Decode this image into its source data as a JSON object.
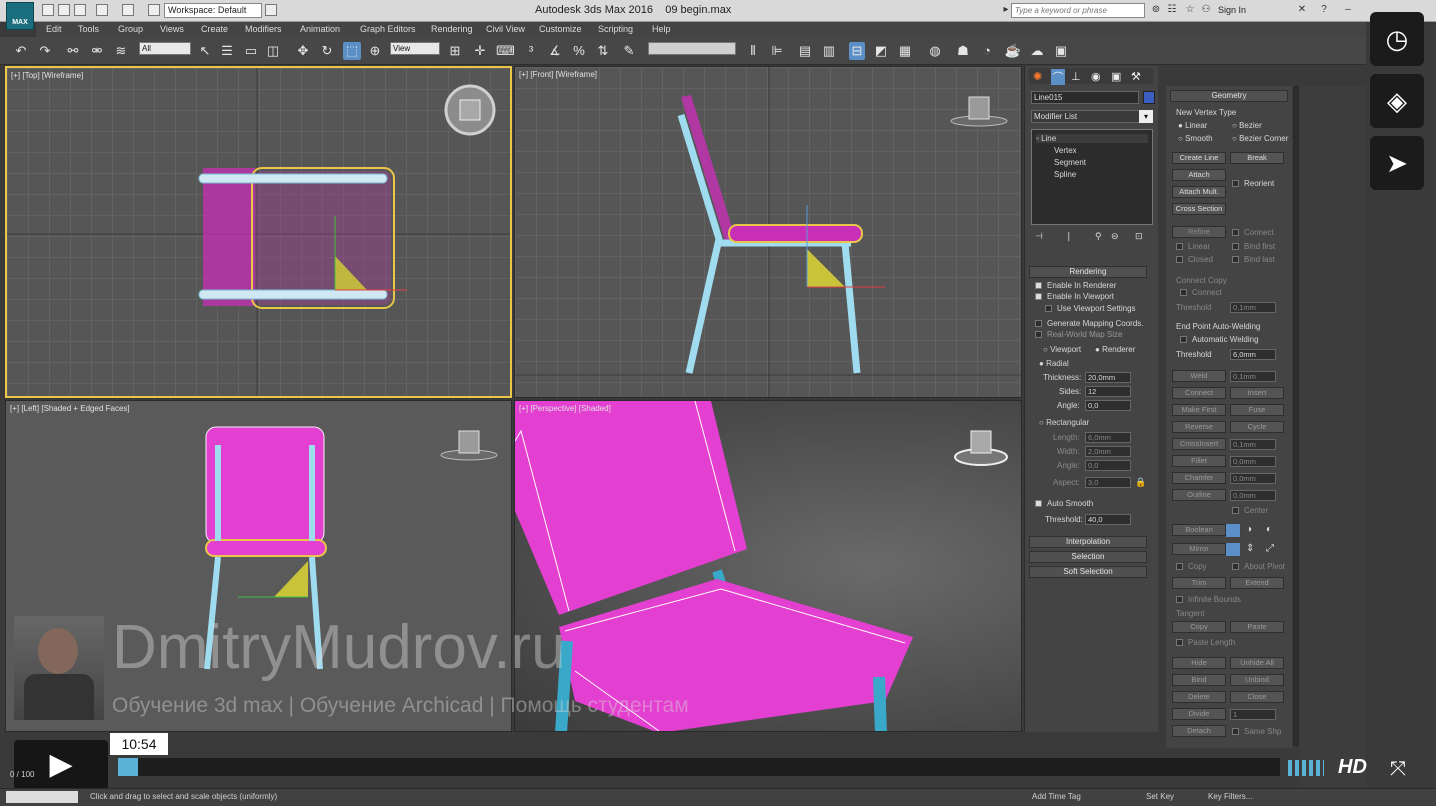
{
  "app": {
    "title": "Autodesk 3ds Max 2016",
    "file": "09 begin.max",
    "logo": "MAX",
    "workspace": "Workspace: Default",
    "search_placeholder": "Type a keyword or phrase",
    "signin": "Sign In"
  },
  "menu": [
    "Edit",
    "Tools",
    "Group",
    "Views",
    "Create",
    "Modifiers",
    "Animation",
    "Graph Editors",
    "Rendering",
    "Civil View",
    "Customize",
    "Scripting",
    "Help"
  ],
  "toolbar": {
    "selection_filter": "All",
    "ref_coord": "View"
  },
  "viewports": {
    "top": "[+] [Top] [Wireframe]",
    "front": "[+] [Front] [Wireframe]",
    "left": "[+] [Left] [Shaded + Edged Faces]",
    "perspective": "[+] [Perspective] [Shaded]"
  },
  "command_panel": {
    "object_name": "Line015",
    "modifier_list": "Modifier List",
    "stack": [
      "Line",
      "Vertex",
      "Segment",
      "Spline"
    ],
    "rendering": {
      "title": "Rendering",
      "enable_renderer": "Enable In Renderer",
      "enable_viewport": "Enable In Viewport",
      "use_viewport_settings": "Use Viewport Settings",
      "gen_mapping": "Generate Mapping Coords.",
      "real_world": "Real-World Map Size",
      "viewport_radio": "Viewport",
      "renderer_radio": "Renderer",
      "radial": "Radial",
      "thickness_label": "Thickness:",
      "thickness": "20,0mm",
      "sides_label": "Sides:",
      "sides": "12",
      "angle_label": "Angle:",
      "angle": "0,0",
      "rectangular": "Rectangular",
      "length_label": "Length:",
      "length": "6,0mm",
      "width_label": "Width:",
      "width": "2,0mm",
      "rect_angle_label": "Angle:",
      "rect_angle": "0,0",
      "aspect_label": "Aspect:",
      "aspect": "3,0",
      "auto_smooth": "Auto Smooth",
      "threshold_label": "Threshold:",
      "threshold": "40,0"
    },
    "rollouts": [
      "Interpolation",
      "Selection",
      "Soft Selection"
    ]
  },
  "geometry_panel": {
    "title": "Geometry",
    "new_vertex_type": "New Vertex Type",
    "linear": "Linear",
    "bezier": "Bezier",
    "smooth": "Smooth",
    "bezier_corner": "Bezier Corner",
    "create_line": "Create Line",
    "break": "Break",
    "attach": "Attach",
    "reorient": "Reorient",
    "attach_mult": "Attach Mult.",
    "cross_section": "Cross Section",
    "refine": "Refine",
    "connect": "Connect",
    "linear_c": "Linear",
    "bind_first": "Bind first",
    "closed": "Closed",
    "bind_last": "Bind last",
    "connect_copy": "Connect Copy",
    "connect_chk": "Connect",
    "threshold_label": "Threshold",
    "threshold": "0,1mm",
    "end_point_welding": "End Point Auto-Welding",
    "automatic_welding": "Automatic Welding",
    "weld_threshold_label": "Threshold",
    "weld_threshold": "6,0mm",
    "weld": "Weld",
    "weld_val": "0,1mm",
    "connect_btn": "Connect",
    "insert": "Insert",
    "make_first": "Make First",
    "fuse": "Fuse",
    "reverse": "Reverse",
    "cycle": "Cycle",
    "crossinsert": "CrossInsert",
    "crossinsert_val": "0,1mm",
    "fillet": "Fillet",
    "fillet_val": "0,0mm",
    "chamfer": "Chamfer",
    "chamfer_val": "0,0mm",
    "outline": "Outline",
    "outline_val": "0,0mm",
    "center": "Center",
    "boolean": "Boolean",
    "mirror": "Mirror",
    "copy": "Copy",
    "about_pivot": "About Pivot",
    "trim": "Trim",
    "extend": "Extend",
    "infinite_bounds": "Infinite Bounds",
    "tangent": "Tangent",
    "copy_t": "Copy",
    "paste": "Paste",
    "paste_length": "Paste Length",
    "hide": "Hide",
    "unhide_all": "Unhide All",
    "bind": "Bind",
    "unbind": "Unbind",
    "delete": "Delete",
    "close": "Close",
    "divide": "Divide",
    "divide_val": "1",
    "detach": "Detach",
    "same_shp": "Same Shp"
  },
  "player": {
    "time": "10:54",
    "hd": "HD"
  },
  "status": {
    "prompt": "Click and drag to select and scale objects (uniformly)",
    "frame": "0 / 100",
    "add_time_tag": "Add Time Tag",
    "set_key": "Set Key",
    "key_filters": "Key Filters..."
  },
  "watermark": {
    "name": "DmitryMudrov.ru",
    "tagline": "Обучение 3d max | Обучение Archicad | Помощь студентам"
  },
  "colors": {
    "accent": "#5a8fc7",
    "chair_pink": "#e33fd0",
    "spline_cyan": "#8fd6ee",
    "selection_yellow": "#e9c54a",
    "progress": "#5bb2d9"
  }
}
